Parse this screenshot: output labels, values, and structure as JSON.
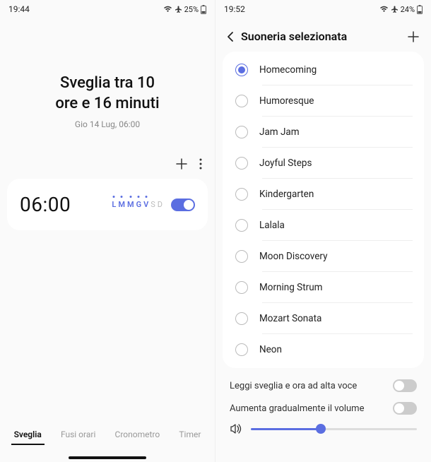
{
  "left": {
    "status": {
      "time": "19:44",
      "battery": "25%"
    },
    "alarm": {
      "title_line1": "Sveglia tra 10",
      "title_line2": "ore e 16 minuti",
      "subtitle": "Gio 14 Lug, 06:00"
    },
    "card": {
      "time": "06:00",
      "days": [
        {
          "letter": "L",
          "on": true
        },
        {
          "letter": "M",
          "on": true
        },
        {
          "letter": "M",
          "on": true
        },
        {
          "letter": "G",
          "on": true
        },
        {
          "letter": "V",
          "on": true
        },
        {
          "letter": "S",
          "on": false
        },
        {
          "letter": "D",
          "on": false
        }
      ],
      "enabled": true
    },
    "tabs": [
      {
        "label": "Sveglia",
        "active": true
      },
      {
        "label": "Fusi orari",
        "active": false
      },
      {
        "label": "Cronometro",
        "active": false
      },
      {
        "label": "Timer",
        "active": false
      }
    ]
  },
  "right": {
    "status": {
      "time": "19:52",
      "battery": "24%"
    },
    "title": "Suoneria selezionata",
    "ringtones": [
      {
        "name": "Homecoming",
        "selected": true
      },
      {
        "name": "Humoresque",
        "selected": false
      },
      {
        "name": "Jam Jam",
        "selected": false
      },
      {
        "name": "Joyful Steps",
        "selected": false
      },
      {
        "name": "Kindergarten",
        "selected": false
      },
      {
        "name": "Lalala",
        "selected": false
      },
      {
        "name": "Moon Discovery",
        "selected": false
      },
      {
        "name": "Morning Strum",
        "selected": false
      },
      {
        "name": "Mozart Sonata",
        "selected": false
      },
      {
        "name": "Neon",
        "selected": false
      }
    ],
    "settings": {
      "tts": {
        "label": "Leggi sveglia e ora ad alta voce",
        "enabled": false
      },
      "gradual": {
        "label": "Aumenta gradualmente il volume",
        "enabled": false
      }
    },
    "volume_percent": 42
  }
}
